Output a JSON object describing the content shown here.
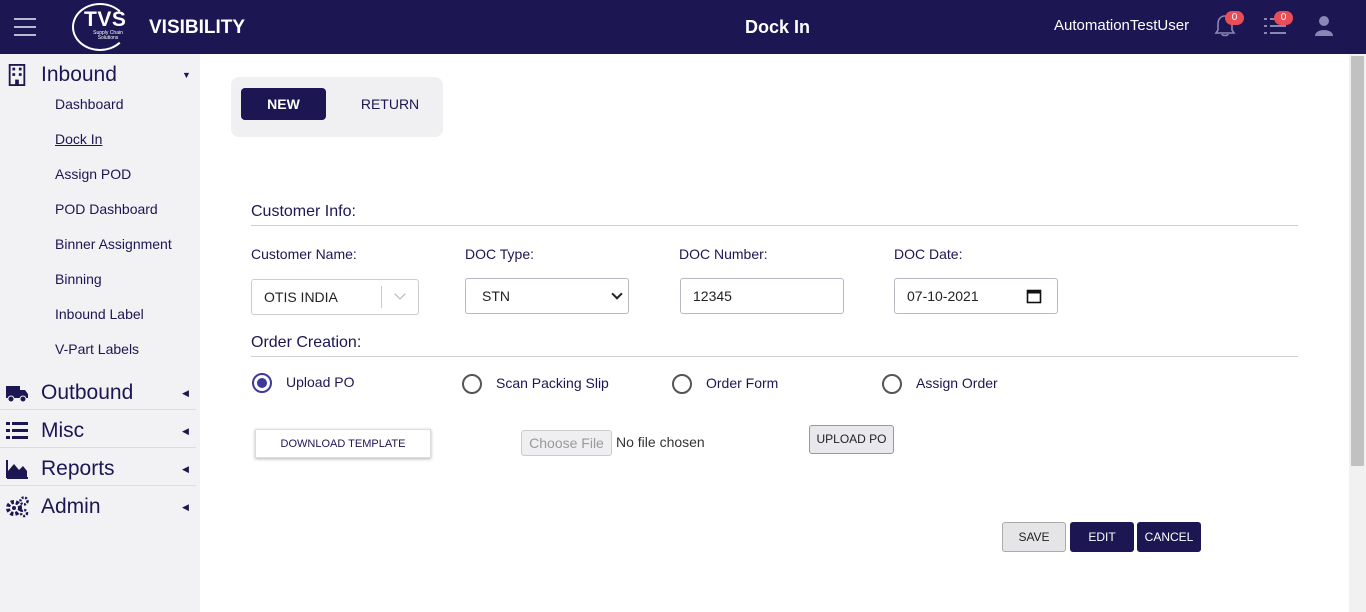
{
  "header": {
    "logo_text": "TVS",
    "logo_sub": "Supply Chain Solutions",
    "brand": "VISIBILITY",
    "page_title": "Dock In",
    "user_name": "AutomationTestUser",
    "notifications_count": "0",
    "tasks_count": "0",
    "accent": "#1c1652",
    "badge_color": "#e94d58"
  },
  "sidebar": {
    "inbound": {
      "label": "Inbound",
      "icon": "building-icon",
      "items": [
        {
          "label": "Dashboard"
        },
        {
          "label": "Dock In"
        },
        {
          "label": "Assign POD"
        },
        {
          "label": "POD Dashboard"
        },
        {
          "label": "Binner Assignment"
        },
        {
          "label": "Binning"
        },
        {
          "label": "Inbound Label"
        },
        {
          "label": "V-Part Labels"
        }
      ]
    },
    "outbound": {
      "label": "Outbound",
      "icon": "truck-icon"
    },
    "misc": {
      "label": "Misc",
      "icon": "list-icon"
    },
    "reports": {
      "label": "Reports",
      "icon": "area-chart-icon"
    },
    "admin": {
      "label": "Admin",
      "icon": "cogs-icon"
    }
  },
  "tabs": {
    "new": "NEW",
    "return": "RETURN"
  },
  "customer_info": {
    "title": "Customer Info:",
    "customer_name_label": "Customer Name:",
    "customer_name_value": "OTIS INDIA",
    "doc_type_label": "DOC Type:",
    "doc_type_value": "STN",
    "doc_number_label": "DOC Number:",
    "doc_number_value": "12345",
    "doc_date_label": "DOC Date:",
    "doc_date_value": "07-10-2021"
  },
  "order_creation": {
    "title": "Order Creation:",
    "options": [
      {
        "label": "Upload PO",
        "selected": true
      },
      {
        "label": "Scan Packing Slip",
        "selected": false
      },
      {
        "label": "Order Form",
        "selected": false
      },
      {
        "label": "Assign Order",
        "selected": false
      }
    ],
    "download_template": "DOWNLOAD TEMPLATE",
    "choose_file": "Choose File",
    "no_file": "No file chosen",
    "upload_po": "UPLOAD PO"
  },
  "actions": {
    "save": "SAVE",
    "edit": "EDIT",
    "cancel": "CANCEL"
  }
}
